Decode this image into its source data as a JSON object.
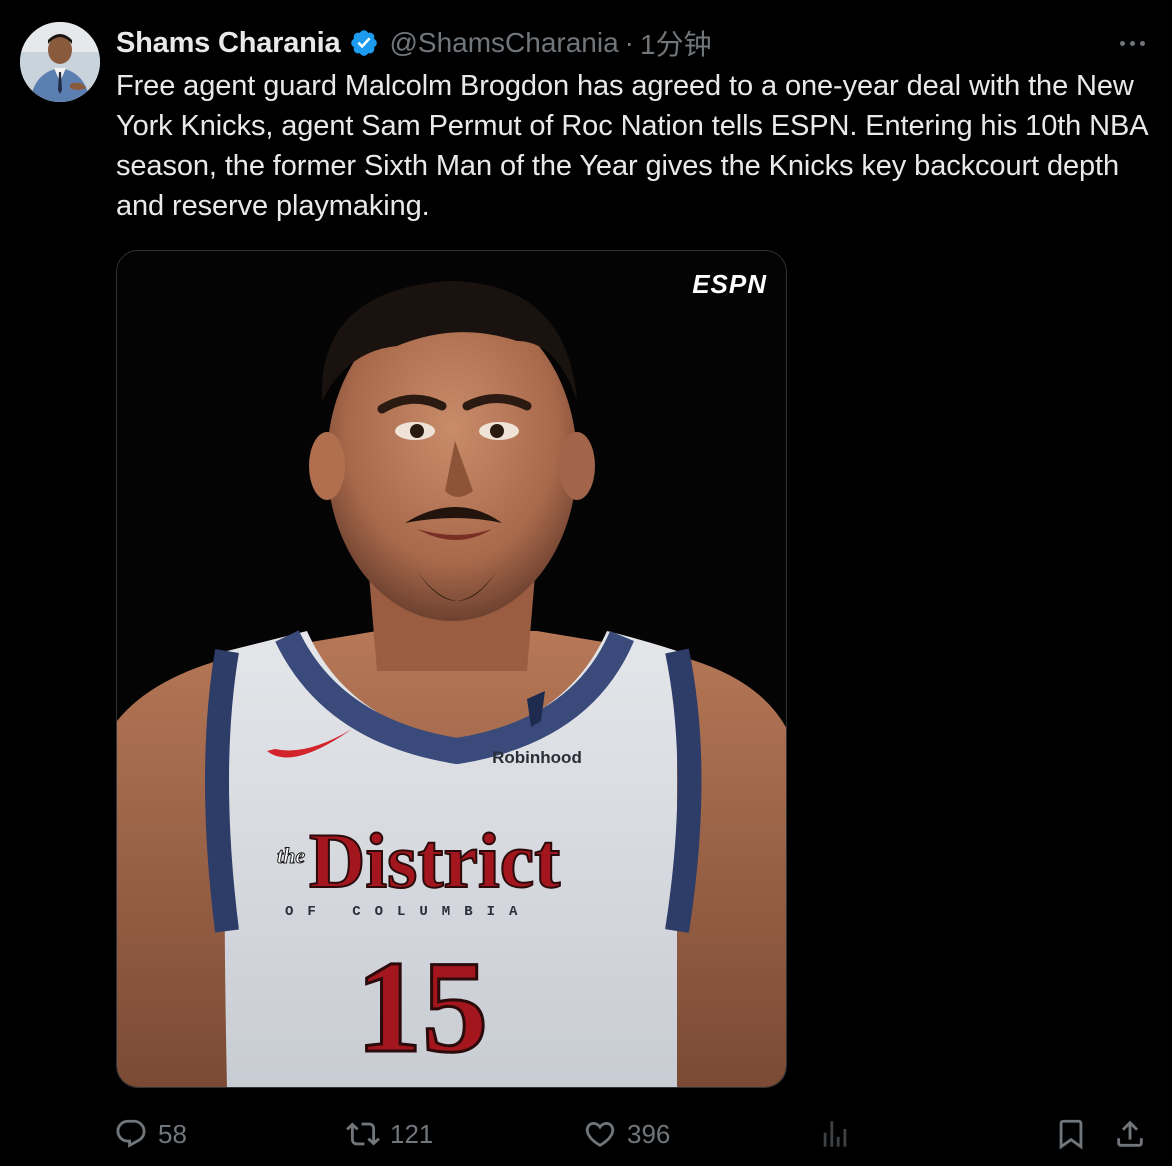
{
  "author": {
    "display_name": "Shams Charania",
    "handle": "@ShamsCharania",
    "time": "1分钟",
    "verified": true,
    "verified_color": "#1d9bf0",
    "avatar_icon": "user-avatar"
  },
  "tweet": {
    "text": "Free agent guard Malcolm Brogdon has agreed to a one-year deal with the New York Knicks, agent Sam Permut of Roc Nation tells ESPN. Entering his 10th NBA season, the former Sixth Man of the Year gives the Knicks key backcourt depth and reserve playmaking."
  },
  "media": {
    "watermark": "ESPN",
    "jersey": {
      "sponsor": "Robinhood",
      "script_small": "the",
      "script_main": "District",
      "subtitle": "OF COLUMBIA",
      "number": "15"
    }
  },
  "actions": {
    "replies": "58",
    "reposts": "121",
    "likes": "396",
    "views": "",
    "icons": [
      "reply-icon",
      "repost-icon",
      "like-icon",
      "views-icon",
      "bookmark-icon",
      "share-icon"
    ]
  },
  "colors": {
    "background": "#000000",
    "text_primary": "#e7e9ea",
    "text_secondary": "#71767b",
    "border": "#2f3336"
  }
}
